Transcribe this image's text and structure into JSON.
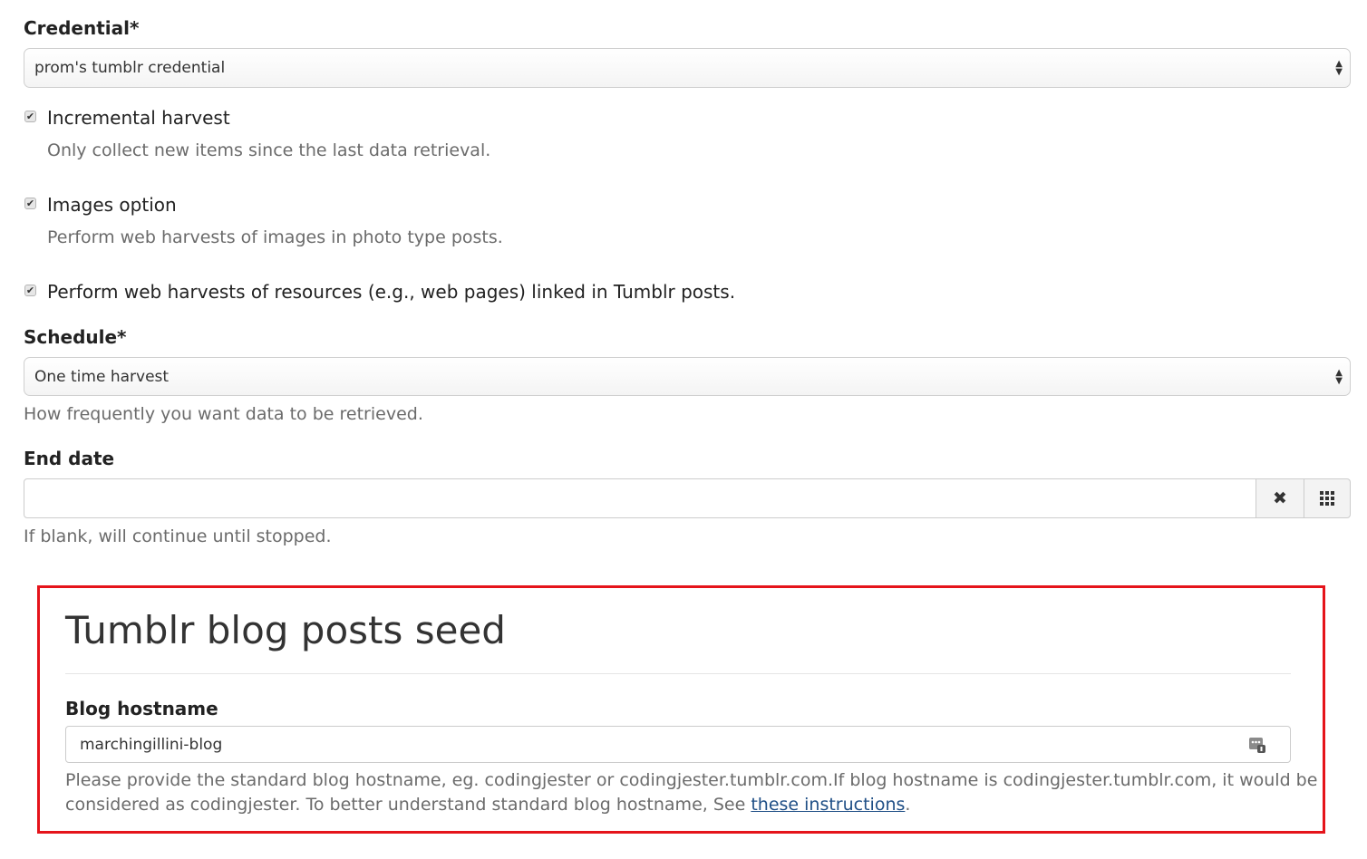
{
  "credential": {
    "label": "Credential*",
    "selected": "prom's tumblr credential"
  },
  "incremental": {
    "checked": true,
    "label": "Incremental harvest",
    "help": "Only collect new items since the last data retrieval."
  },
  "images": {
    "checked": true,
    "label": "Images option",
    "help": "Perform web harvests of images in photo type posts."
  },
  "web_resources": {
    "checked": true,
    "label": "Perform web harvests of resources (e.g., web pages) linked in Tumblr posts."
  },
  "schedule": {
    "label": "Schedule*",
    "selected": "One time harvest",
    "help": "How frequently you want data to be retrieved."
  },
  "end_date": {
    "label": "End date",
    "value": "",
    "help": "If blank, will continue until stopped."
  },
  "seed": {
    "title": "Tumblr blog posts seed",
    "hostname_label": "Blog hostname",
    "hostname_value": "marchingillini-blog",
    "help_line1": "Please provide the standard blog hostname, eg. codingjester or codingjester.tumblr.com.If blog hostname is codingjester.tumblr.com, it would be",
    "help_line2_prefix": "considered as codingjester. To better understand standard blog hostname, See ",
    "help_link": "these instructions",
    "help_line2_suffix": "."
  },
  "icons": {
    "check": "checkmark-icon",
    "clear": "close-icon",
    "calendar": "calendar-grid-icon",
    "select_arrows": "up-down-arrows-icon",
    "autofill": "contact-card-icon"
  },
  "colors": {
    "highlight_border": "#e5141b",
    "link": "#1f4f86"
  }
}
